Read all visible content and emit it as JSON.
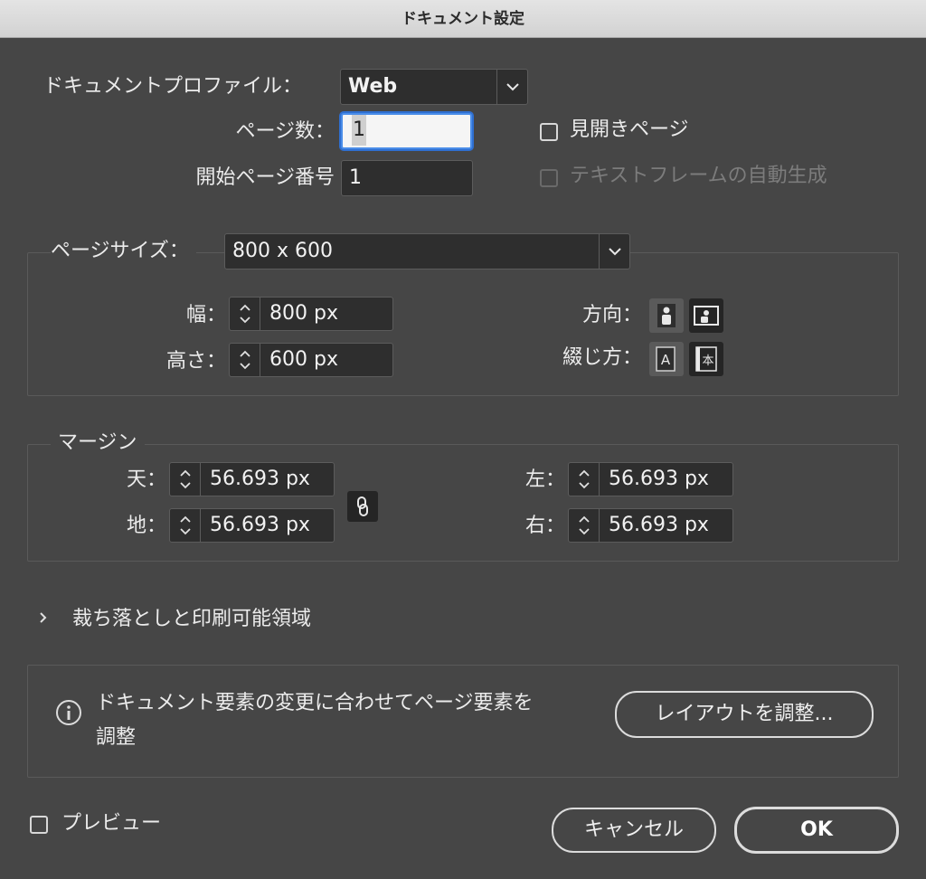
{
  "window": {
    "title": "ドキュメント設定"
  },
  "profile": {
    "label": "ドキュメントプロファイル：",
    "value": "Web"
  },
  "pages": {
    "count_label": "ページ数：",
    "count_value": "1",
    "start_label": "開始ページ番号",
    "start_value": "1",
    "facing_label": "見開きページ",
    "primary_text_frame_label": "テキストフレームの自動生成"
  },
  "page_size": {
    "label": "ページサイズ：",
    "value": "800 x 600",
    "width_label": "幅：",
    "width_value": "800 px",
    "height_label": "高さ：",
    "height_value": "600 px",
    "orientation_label": "方向：",
    "binding_label": "綴じ方：",
    "binding_left_glyph": "A",
    "binding_right_glyph": "本"
  },
  "margins": {
    "label": "マージン",
    "top_label": "天：",
    "top_value": "56.693 px",
    "bottom_label": "地：",
    "bottom_value": "56.693 px",
    "left_label": "左：",
    "left_value": "56.693 px",
    "right_label": "右：",
    "right_value": "56.693 px"
  },
  "bleed": {
    "label": "裁ち落としと印刷可能領域"
  },
  "info": {
    "line1": "ドキュメント要素の変更に合わせてページ要素を",
    "line2": "調整",
    "button": "レイアウトを調整..."
  },
  "footer": {
    "preview_label": "プレビュー",
    "cancel": "キャンセル",
    "ok": "OK"
  }
}
